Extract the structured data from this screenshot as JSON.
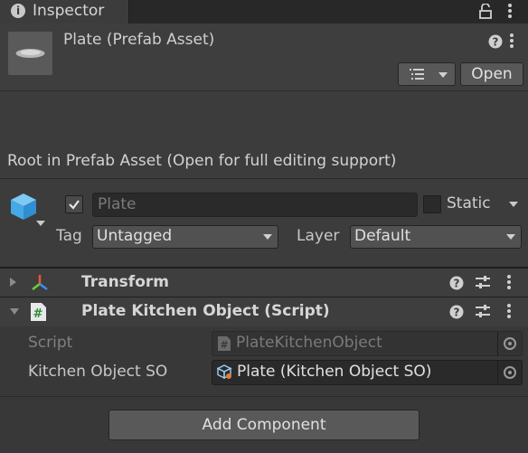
{
  "tab": {
    "title": "Inspector",
    "info_glyph": "i"
  },
  "header": {
    "asset_title": "Plate (Prefab Asset)",
    "open_label": "Open",
    "help_glyph": "?"
  },
  "root_note": "Root in Prefab Asset (Open for full editing support)",
  "gameobject": {
    "active_checked": true,
    "name_value": "Plate",
    "static_label": "Static",
    "static_checked": false,
    "tag_label": "Tag",
    "tag_value": "Untagged",
    "layer_label": "Layer",
    "layer_value": "Default"
  },
  "components": [
    {
      "title": "Transform",
      "expanded": false,
      "icon": "transform-axes-icon"
    },
    {
      "title": "Plate Kitchen Object (Script)",
      "expanded": true,
      "icon": "script-hash-icon"
    }
  ],
  "script_fields": {
    "script_label": "Script",
    "script_value": "PlateKitchenObject",
    "kso_label": "Kitchen Object SO",
    "kso_value": "Plate (Kitchen Object SO)"
  },
  "add_component_label": "Add Component",
  "colors": {
    "background": "#383838",
    "transform_x": "#e8563a",
    "transform_y": "#6fcf3a",
    "transform_z": "#3a8ee8",
    "cube_icon": "#47a8e8"
  }
}
